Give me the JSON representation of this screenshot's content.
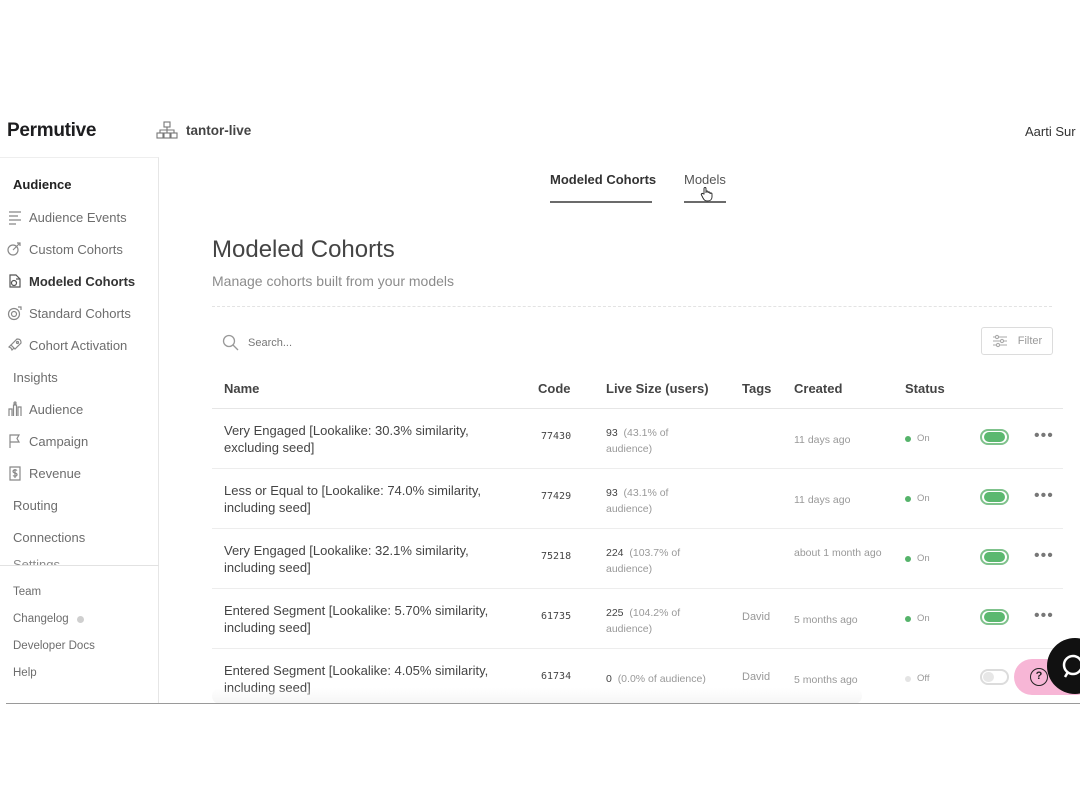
{
  "app": {
    "brand": "Permutive",
    "workspace": "tantor-live",
    "user": "Aarti Sur"
  },
  "sidebar": {
    "section_title": "Audience",
    "items": [
      {
        "label": "Audience Events",
        "icon": "list-icon"
      },
      {
        "label": "Custom Cohorts",
        "icon": "cohort-icon"
      },
      {
        "label": "Modeled Cohorts",
        "icon": "modeled-cohort-icon",
        "active": true
      },
      {
        "label": "Standard Cohorts",
        "icon": "standard-cohort-icon"
      },
      {
        "label": "Cohort Activation",
        "icon": "rocket-icon"
      }
    ],
    "insights_label": "Insights",
    "insights_items": [
      {
        "label": "Audience",
        "icon": "bar-chart-icon"
      },
      {
        "label": "Campaign",
        "icon": "flag-icon"
      },
      {
        "label": "Revenue",
        "icon": "dollar-icon"
      }
    ],
    "routing_label": "Routing",
    "connections_label": "Connections",
    "cut_label": "Settings",
    "footer": {
      "team": "Team",
      "changelog": "Changelog",
      "developer_docs": "Developer Docs",
      "help": "Help"
    }
  },
  "tabs": {
    "modeled_cohorts": "Modeled Cohorts",
    "models": "Models"
  },
  "header": {
    "title": "Modeled Cohorts",
    "subtitle": "Manage cohorts built from your models"
  },
  "search": {
    "placeholder": "Search..."
  },
  "filter": {
    "label": "Filter"
  },
  "table": {
    "columns": {
      "name": "Name",
      "code": "Code",
      "live_size": "Live Size (users)",
      "tags": "Tags",
      "created": "Created",
      "status": "Status"
    },
    "rows": [
      {
        "name": "Very Engaged [Lookalike: 30.3% similarity, excluding seed]",
        "code": "77430",
        "size": "93",
        "pct": "(43.1% of audience)",
        "tags": "",
        "created": "11 days ago",
        "status": "On"
      },
      {
        "name": "Less or Equal to [Lookalike: 74.0% similarity, including seed]",
        "code": "77429",
        "size": "93",
        "pct": "(43.1% of audience)",
        "tags": "",
        "created": "11 days ago",
        "status": "On"
      },
      {
        "name": "Very Engaged [Lookalike: 32.1% similarity, including seed]",
        "code": "75218",
        "size": "224",
        "pct": "(103.7% of audience)",
        "tags": "",
        "created": "about 1 month ago",
        "status": "On"
      },
      {
        "name": "Entered Segment [Lookalike: 5.70% similarity, including seed]",
        "code": "61735",
        "size": "225",
        "pct": "(104.2% of audience)",
        "tags": "David",
        "created": "5 months ago",
        "status": "On"
      },
      {
        "name": "Entered Segment [Lookalike: 4.05% similarity, including seed]",
        "code": "61734",
        "size": "0",
        "pct": "(0.0% of audience)",
        "tags": "David",
        "created": "5 months ago",
        "status": "Off"
      }
    ]
  },
  "help_widget": {
    "label": "?"
  }
}
